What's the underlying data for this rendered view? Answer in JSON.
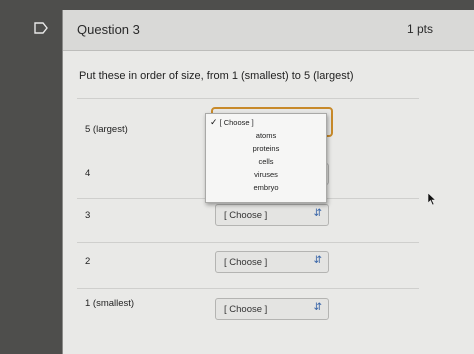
{
  "question": {
    "title": "Question 3",
    "points": "1 pts",
    "prompt": "Put these in order of size, from 1 (smallest) to 5 (largest)"
  },
  "rows": [
    {
      "label": "5 (largest)",
      "value": "[ Choose ]"
    },
    {
      "label": "4",
      "value": ""
    },
    {
      "label": "3",
      "value": "[ Choose ]"
    },
    {
      "label": "2",
      "value": "[ Choose ]"
    },
    {
      "label": "1 (smallest)",
      "value": "[ Choose ]"
    }
  ],
  "dropdown": {
    "selected": "[ Choose ]",
    "check": "✓",
    "options": [
      "atoms",
      "proteins",
      "cells",
      "viruses",
      "embryo"
    ]
  },
  "icons": {
    "flag": "flag-icon",
    "chevron": "chevron-updown-icon",
    "cursor": "mouse-cursor-icon"
  },
  "colors": {
    "focus_border": "#c88a2a",
    "chevron": "#3a66a8"
  }
}
